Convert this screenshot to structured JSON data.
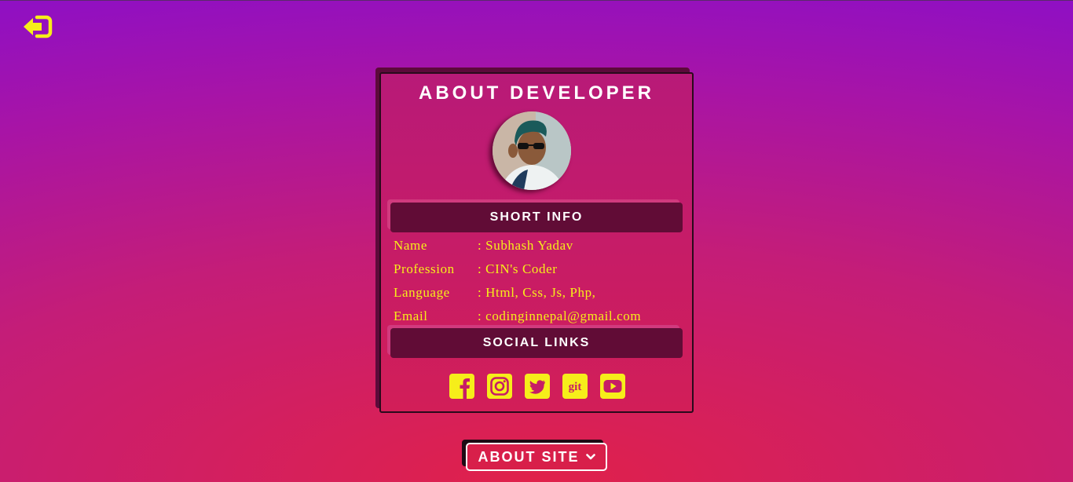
{
  "nav": {
    "back_icon": "sign-out-icon"
  },
  "card": {
    "title": "ABOUT DEVELOPER",
    "avatar": "developer-photo",
    "short_info": {
      "heading": "SHORT INFO",
      "rows": [
        {
          "label": "Name",
          "value": ": Subhash Yadav"
        },
        {
          "label": "Profession",
          "value": ": CIN's Coder"
        },
        {
          "label": "Language",
          "value": ": Html, Css, Js, Php,"
        },
        {
          "label": "Email",
          "value": ": codinginnepal@gmail.com"
        }
      ]
    },
    "social": {
      "heading": "SOCIAL LINKS",
      "icons": [
        "facebook-icon",
        "instagram-icon",
        "twitter-icon",
        "git-icon",
        "youtube-icon"
      ],
      "git_text": "git"
    }
  },
  "footer": {
    "about_site_label": "ABOUT SITE"
  },
  "colors": {
    "accent": "#f6ee1a",
    "bar": "#610c36",
    "text": "#ffffff"
  }
}
